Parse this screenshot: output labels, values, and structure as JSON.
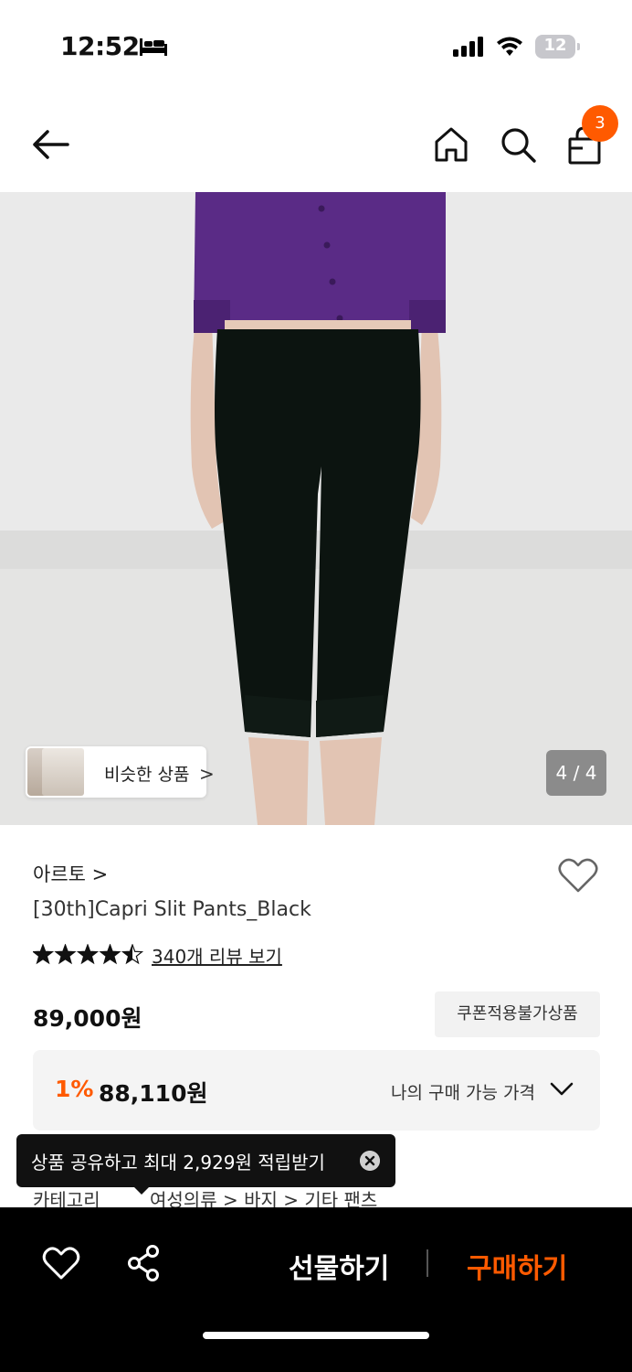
{
  "status_bar": {
    "time": "12:52",
    "battery": "12"
  },
  "nav": {
    "cart_count": "3"
  },
  "gallery": {
    "similar_label": "비슷한 상품",
    "similar_chevron": ">",
    "counter": "4 / 4"
  },
  "product": {
    "brand": "아르토",
    "brand_chevron": ">",
    "name": "[30th]Capri Slit Pants_Black",
    "rating": 4.5,
    "review_link": "340개 리뷰 보기",
    "price": "89,000원",
    "coupon_tag": "쿠폰적용불가상품",
    "my_discount": "1%",
    "my_price": "88,110원",
    "my_price_label": "나의 구매 가능 가격"
  },
  "category": {
    "label": "카테고리",
    "path": "여성의류 > 바지 > 기타 팬츠"
  },
  "tooltip": {
    "text": "상품 공유하고 최대 2,929원 적립받기"
  },
  "bottom_bar": {
    "gift_label": "선물하기",
    "buy_label": "구매하기"
  },
  "colors": {
    "accent": "#ff5a00",
    "bar_bg": "#000000"
  }
}
